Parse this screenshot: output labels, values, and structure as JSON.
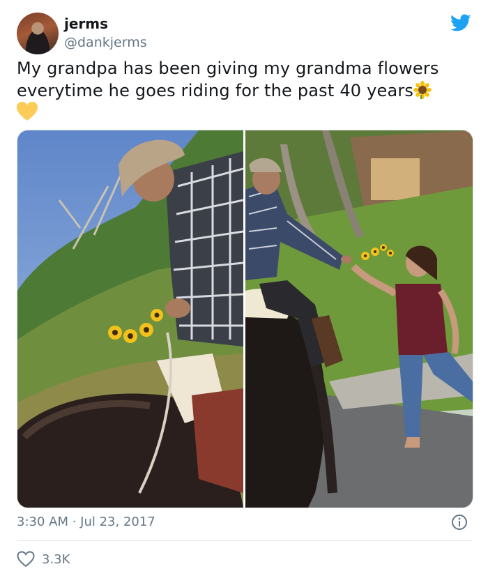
{
  "user": {
    "display_name": "jerms",
    "handle": "@dankjerms",
    "avatar_icon": "avatar"
  },
  "tweet": {
    "text": "My grandpa has been giving my grandma flowers everytime he goes riding for the past 40 years",
    "emojis": [
      "sunflower-icon",
      "yellow-heart-icon"
    ],
    "media": [
      {
        "description_icon": "photo-grandpa-on-horse"
      },
      {
        "description_icon": "photo-grandpa-giving-flowers"
      }
    ],
    "timestamp": "3:30 AM · Jul 23, 2017",
    "likes": "3.3K"
  },
  "colors": {
    "twitter_blue": "#1da1f2",
    "muted": "#657786",
    "text": "#14171a"
  }
}
